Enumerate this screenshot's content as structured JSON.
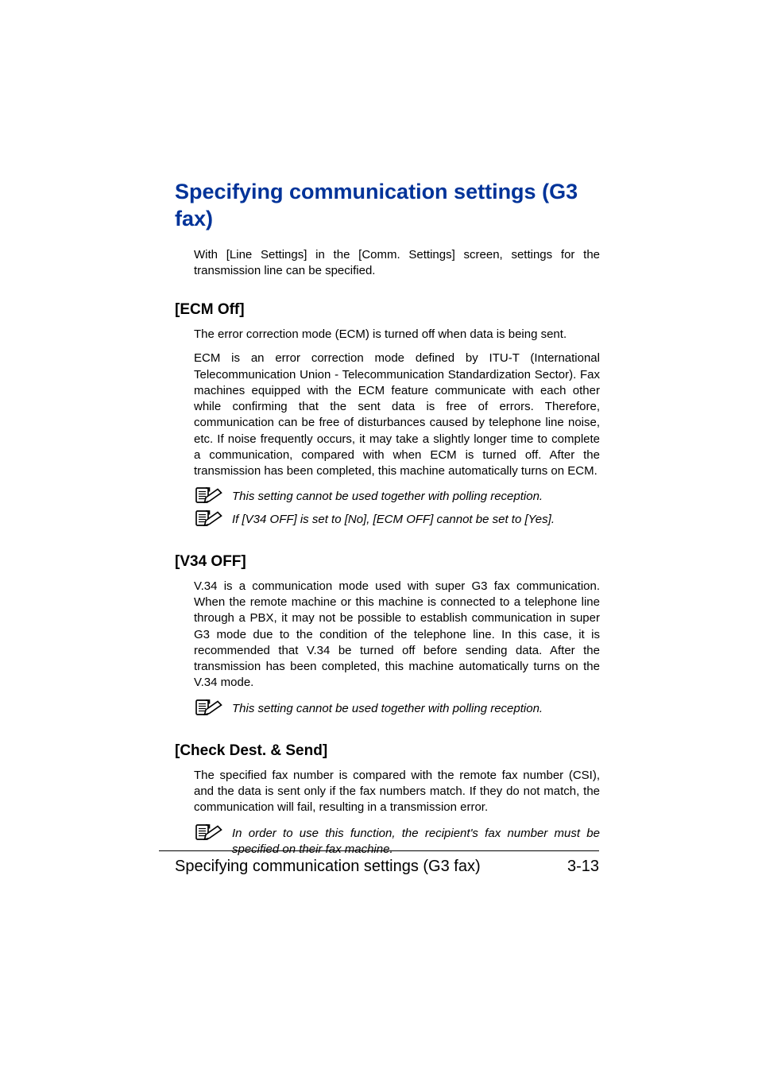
{
  "title": "Specifying communication settings (G3 fax)",
  "intro": "With [Line Settings] in the [Comm. Settings] screen, settings for the transmission line can be specified.",
  "sections": [
    {
      "heading": "[ECM Off]",
      "paragraphs": [
        "The error correction mode (ECM) is turned off when data is being sent.",
        "ECM is an error correction mode defined by ITU-T (International Telecommunication Union - Telecommunication Standardization Sector). Fax machines equipped with the ECM feature communicate with each other while confirming that the sent data is free of errors. Therefore, communication can be free of disturbances caused by telephone line noise, etc. If noise frequently occurs, it may take a slightly longer time to complete a communication, compared with when ECM is turned off. After the transmission has been completed, this machine automatically turns on ECM."
      ],
      "notes": [
        "This setting cannot be used together with polling reception.",
        "If [V34 OFF] is set to [No], [ECM OFF] cannot be set to [Yes]."
      ]
    },
    {
      "heading": "[V34 OFF]",
      "paragraphs": [
        "V.34 is a communication mode used with super G3 fax communication. When the remote machine or this machine is connected to a telephone line through a PBX, it may not be possible to establish communication in super G3 mode due to the condition of the telephone line. In this case, it is recommended that V.34 be turned off before sending data. After the transmission has been completed, this machine automatically turns on the V.34 mode."
      ],
      "notes": [
        "This setting cannot be used together with polling reception."
      ]
    },
    {
      "heading": "[Check Dest. & Send]",
      "paragraphs": [
        "The specified fax number is compared with the remote fax number (CSI), and the data is sent only if the fax numbers match. If they do not match, the communication will fail, resulting in a transmission error."
      ],
      "notes": [
        "In order to use this function, the recipient's fax number must be specified on their fax machine."
      ]
    }
  ],
  "footer": {
    "left": "Specifying communication settings (G3 fax)",
    "right": "3-13"
  }
}
